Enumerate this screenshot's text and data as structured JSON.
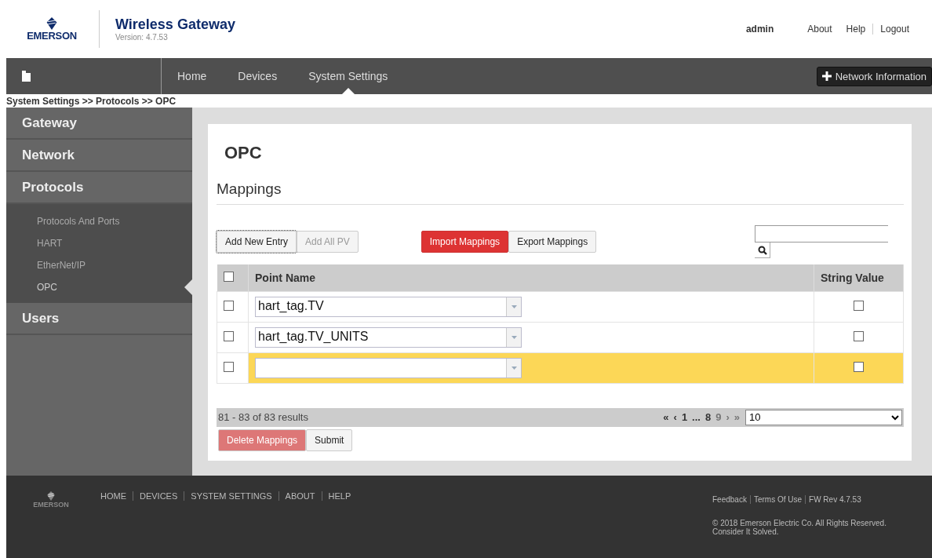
{
  "header": {
    "logo": "EMERSON",
    "title": "Wireless Gateway",
    "version": "Version: 4.7.53",
    "user": "admin",
    "links": [
      "About",
      "Help",
      "Logout"
    ]
  },
  "nav": {
    "tabs": [
      {
        "label": "Home",
        "selected": false
      },
      {
        "label": "Devices",
        "selected": false
      },
      {
        "label": "System Settings",
        "selected": true
      }
    ],
    "network_button": "Network Information"
  },
  "breadcrumb": "System Settings >> Protocols >> OPC",
  "sidebar": {
    "items": [
      {
        "label": "Gateway"
      },
      {
        "label": "Network"
      },
      {
        "label": "Protocols",
        "children": [
          {
            "label": "Protocols And Ports",
            "selected": false
          },
          {
            "label": "HART",
            "selected": false
          },
          {
            "label": "EtherNet/IP",
            "selected": false
          },
          {
            "label": "OPC",
            "selected": true
          }
        ]
      },
      {
        "label": "Users"
      }
    ]
  },
  "page": {
    "title": "OPC",
    "section": "Mappings",
    "buttons": [
      {
        "label": "Add New Entry",
        "disabled": false
      },
      {
        "label": "Add All PV",
        "disabled": true
      }
    ],
    "import_button": "Import Mappings",
    "export_button": "Export Mappings",
    "table": {
      "select_all": false,
      "columns": [
        "Point Name",
        "String Value"
      ],
      "rows": [
        {
          "checked": false,
          "point_name": "hart_tag.TV",
          "string_value": false,
          "highlighted": false
        },
        {
          "checked": false,
          "point_name": "hart_tag.TV_UNITS",
          "string_value": false,
          "highlighted": false
        },
        {
          "checked": false,
          "point_name": "",
          "string_value": false,
          "highlighted": true
        }
      ]
    },
    "results": "81 - 83 of 83 results",
    "pager": [
      {
        "label": "«",
        "disabled": false
      },
      {
        "label": "‹",
        "disabled": false
      },
      {
        "label": "1",
        "disabled": false
      },
      {
        "label": "...",
        "disabled": false
      },
      {
        "label": "8",
        "disabled": false
      },
      {
        "label": "9",
        "disabled": true
      },
      {
        "label": "›",
        "disabled": true
      },
      {
        "label": "»",
        "disabled": true
      }
    ],
    "page_size": "10",
    "delete_button": "Delete Mappings",
    "submit_button": "Submit"
  },
  "footer": {
    "logo": "EMERSON",
    "links": [
      "HOME",
      "DEVICES",
      "SYSTEM SETTINGS",
      "ABOUT",
      "HELP"
    ],
    "legal_links": [
      "Feedback",
      "Terms Of Use",
      "FW Rev 4.7.53"
    ],
    "copyright": "© 2018 Emerson Electric Co. All Rights Reserved.",
    "tagline": "Consider It Solved."
  }
}
